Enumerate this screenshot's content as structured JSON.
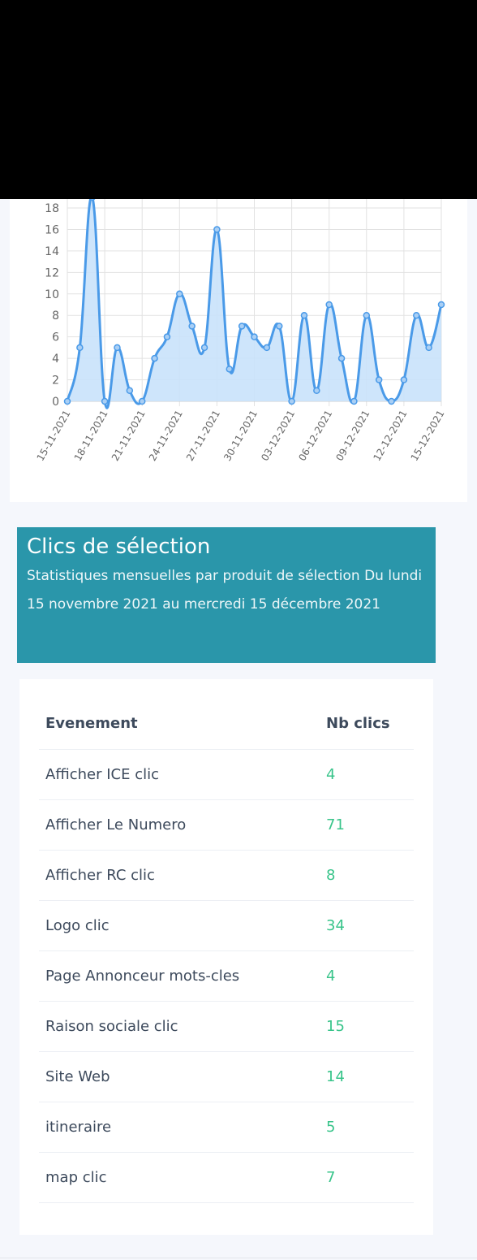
{
  "section": {
    "title": "Clics de sélection",
    "subtitle": "Statistiques mensuelles par produit de sélection Du lundi 15 novembre 2021 au mercredi 15 décembre 2021"
  },
  "table": {
    "headers": [
      "Evenement",
      "Nb clics"
    ],
    "rows": [
      {
        "event": "Afficher ICE clic",
        "count": "4"
      },
      {
        "event": "Afficher Le Numero",
        "count": "71"
      },
      {
        "event": "Afficher RC clic",
        "count": "8"
      },
      {
        "event": "Logo clic",
        "count": "34"
      },
      {
        "event": "Page Annonceur mots-cles",
        "count": "4"
      },
      {
        "event": "Raison sociale clic",
        "count": "15"
      },
      {
        "event": "Site Web",
        "count": "14"
      },
      {
        "event": "itineraire",
        "count": "5"
      },
      {
        "event": "map clic",
        "count": "7"
      }
    ]
  },
  "colors": {
    "line": "#4a9ae8",
    "fill": "#c9e2fb",
    "header_bg": "#2a96aa",
    "count_text": "#38c48a"
  },
  "chart_data": {
    "type": "area",
    "x": [
      "15-11-2021",
      "16-11-2021",
      "17-11-2021",
      "18-11-2021",
      "19-11-2021",
      "20-11-2021",
      "21-11-2021",
      "22-11-2021",
      "23-11-2021",
      "24-11-2021",
      "25-11-2021",
      "26-11-2021",
      "27-11-2021",
      "28-11-2021",
      "29-11-2021",
      "30-11-2021",
      "01-12-2021",
      "02-12-2021",
      "03-12-2021",
      "04-12-2021",
      "05-12-2021",
      "06-12-2021",
      "07-12-2021",
      "08-12-2021",
      "09-12-2021",
      "10-12-2021",
      "11-12-2021",
      "12-12-2021",
      "13-12-2021",
      "14-12-2021",
      "15-12-2021"
    ],
    "values": [
      0,
      5,
      19,
      0,
      5,
      1,
      0,
      4,
      6,
      10,
      7,
      5,
      16,
      3,
      7,
      6,
      5,
      7,
      0,
      8,
      1,
      9,
      4,
      0,
      8,
      2,
      0,
      2,
      8,
      5,
      9
    ],
    "x_tick_labels": [
      "15-11-2021",
      "18-11-2021",
      "21-11-2021",
      "24-11-2021",
      "27-11-2021",
      "30-11-2021",
      "03-12-2021",
      "06-12-2021",
      "09-12-2021",
      "12-12-2021",
      "15-12-2021"
    ],
    "y_tick_labels": [
      "0",
      "2",
      "4",
      "6",
      "8",
      "10",
      "12",
      "14",
      "16",
      "18"
    ],
    "ylim": [
      0,
      18
    ],
    "grid": true
  }
}
